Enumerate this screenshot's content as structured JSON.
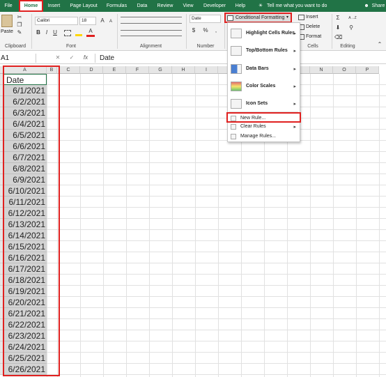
{
  "tabs": [
    {
      "label": "File"
    },
    {
      "label": "Home"
    },
    {
      "label": "Insert"
    },
    {
      "label": "Page Layout"
    },
    {
      "label": "Formulas"
    },
    {
      "label": "Data"
    },
    {
      "label": "Review"
    },
    {
      "label": "View"
    },
    {
      "label": "Developer"
    },
    {
      "label": "Help"
    },
    {
      "label": "Tell me what you want to do"
    },
    {
      "label": "Share"
    }
  ],
  "ribbon": {
    "paste_label": "Paste",
    "font_name": "Calibri",
    "font_size": "18",
    "number_format": "Date",
    "conditional_formatting": "Conditional Formatting",
    "insert": "Insert",
    "delete": "Delete",
    "format": "Format",
    "groups": {
      "clipboard": "Clipboard",
      "font": "Font",
      "alignment": "Alignment",
      "number": "Number",
      "cells": "Cells",
      "editing": "Editing"
    },
    "glyph_bold": "B",
    "glyph_italic": "I",
    "glyph_underline": "U",
    "glyph_a": "A",
    "glyph_dollar": "$",
    "glyph_percent": "%",
    "glyph_comma": ",",
    "glyph_sigma": "Σ",
    "glyph_sort": "A→Z"
  },
  "formula_bar": {
    "name_box": "A1",
    "cancel": "✕",
    "enter": "✓",
    "fx": "fx",
    "content": "Date"
  },
  "columns": [
    "A",
    "B",
    "C",
    "D",
    "E",
    "F",
    "G",
    "H",
    "I",
    "J",
    "K",
    "L",
    "M",
    "N",
    "O",
    "P"
  ],
  "cells": [
    "Date",
    "6/1/2021",
    "6/2/2021",
    "6/3/2021",
    "6/4/2021",
    "6/5/2021",
    "6/6/2021",
    "6/7/2021",
    "6/8/2021",
    "6/9/2021",
    "6/10/2021",
    "6/11/2021",
    "6/12/2021",
    "6/13/2021",
    "6/14/2021",
    "6/15/2021",
    "6/16/2021",
    "6/17/2021",
    "6/18/2021",
    "6/19/2021",
    "6/20/2021",
    "6/21/2021",
    "6/22/2021",
    "6/23/2021",
    "6/24/2021",
    "6/25/2021",
    "6/26/2021"
  ],
  "menu": {
    "highlight": "Highlight Cells Rules",
    "topbottom": "Top/Bottom Rules",
    "databars": "Data Bars",
    "colorscales": "Color Scales",
    "iconsets": "Icon Sets",
    "newrule": "New Rule...",
    "clearrules": "Clear Rules",
    "managerules": "Manage Rules..."
  },
  "icons": [
    "paste-icon",
    "cut-icon",
    "copy-icon",
    "format-painter-icon",
    "bold-icon",
    "italic-icon",
    "underline-icon",
    "borders-icon",
    "fill-color-icon",
    "font-color-icon",
    "align-icons",
    "wrap-icon",
    "merge-icon",
    "currency-icon",
    "percent-icon",
    "comma-icon",
    "lightbulb-icon",
    "share-icon",
    "autosum-icon",
    "fill-icon",
    "clear-icon",
    "sort-icon",
    "find-icon",
    "chevron-right-icon"
  ],
  "colors": {
    "ribbon_green": "#217346",
    "highlight_red": "#e0201f",
    "selected_cells": "#d3d3d3"
  }
}
